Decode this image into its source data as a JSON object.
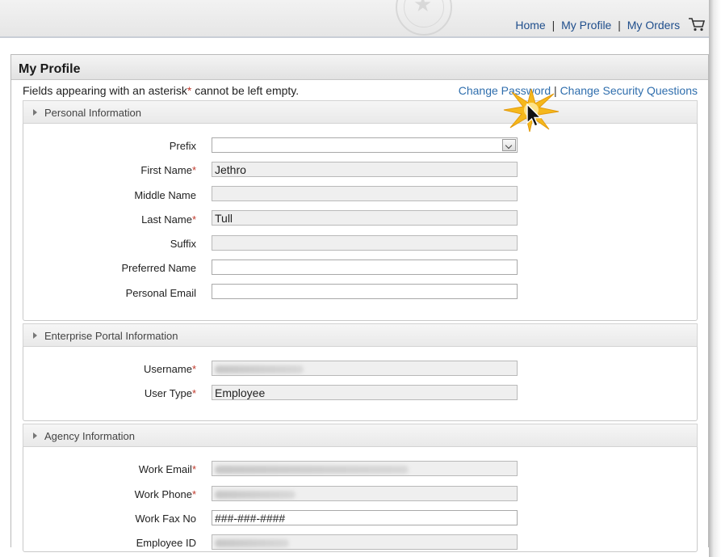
{
  "nav": {
    "home": "Home",
    "sep1": "|",
    "my_profile": "My Profile",
    "sep2": "|",
    "my_orders": "My Orders"
  },
  "panel": {
    "title": "My Profile"
  },
  "notice": {
    "before": "Fields appearing with an asterisk",
    "asterisk": "*",
    "after": " cannot be left empty."
  },
  "links": {
    "change_password": "Change Password",
    "sep": "|",
    "change_security": "Change Security Questions"
  },
  "sections": {
    "personal": {
      "title": "Personal Information",
      "prefix_label": "Prefix",
      "prefix_value": "",
      "first_name_label": "First Name",
      "first_name_value": "Jethro",
      "middle_name_label": "Middle Name",
      "middle_name_value": "",
      "last_name_label": "Last Name",
      "last_name_value": "Tull",
      "suffix_label": "Suffix",
      "suffix_value": "",
      "preferred_name_label": "Preferred Name",
      "preferred_name_value": "",
      "personal_email_label": "Personal Email",
      "personal_email_value": ""
    },
    "enterprise": {
      "title": "Enterprise Portal Information",
      "username_label": "Username",
      "user_type_label": "User Type",
      "user_type_value": "Employee"
    },
    "agency": {
      "title": "Agency Information",
      "work_email_label": "Work Email",
      "work_phone_label": "Work Phone",
      "work_fax_label": "Work Fax No",
      "work_fax_value": "###-###-####",
      "employee_id_label": "Employee ID"
    }
  },
  "required_marker": "*",
  "colors": {
    "link": "#2f6ead",
    "required": "#c0392b",
    "readonly_bg": "#efefef",
    "highlight": "#f5b81c"
  },
  "icons": {
    "cart": "shopping-cart-icon",
    "caret": "caret-right-icon",
    "cursor": "mouse-pointer-icon",
    "spark": "click-highlight-icon",
    "seal": "state-seal-icon"
  }
}
